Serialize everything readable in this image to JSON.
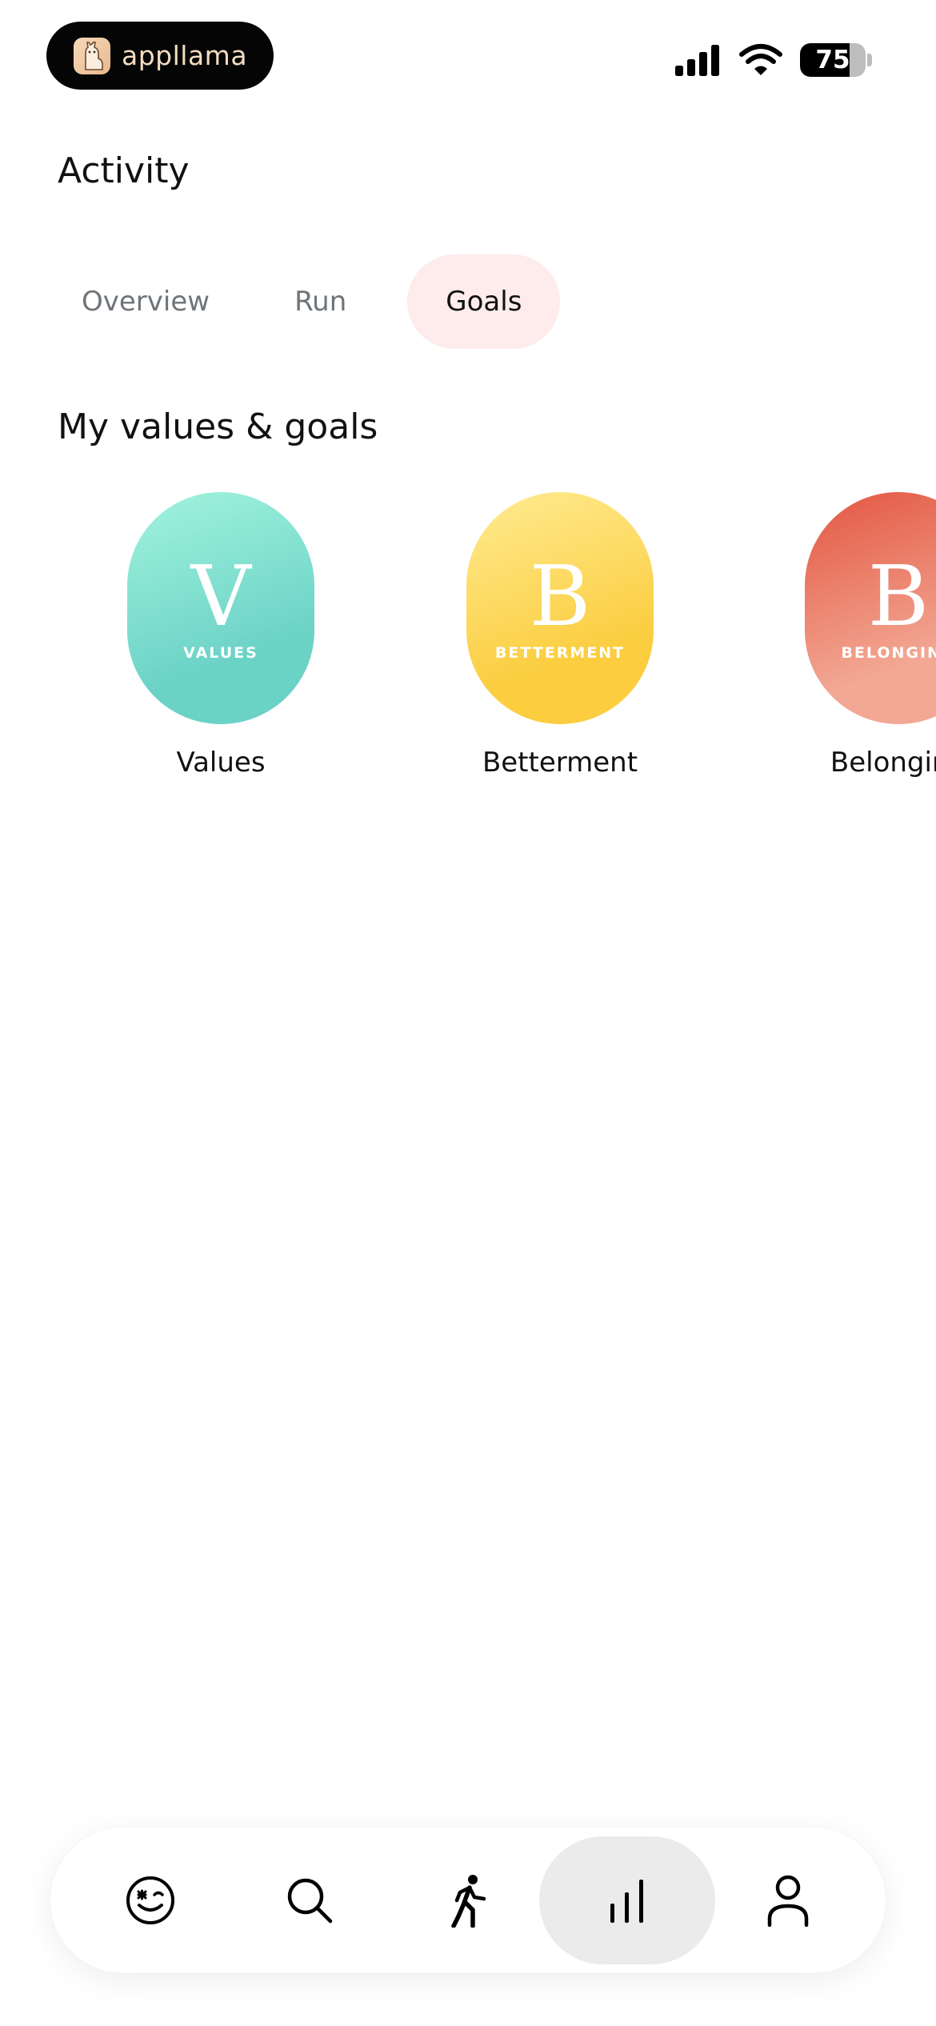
{
  "status_bar": {
    "brand": "appllama",
    "battery": "75",
    "battery_level": 0.75
  },
  "header": {
    "title": "Activity"
  },
  "tabs": [
    {
      "label": "Overview",
      "active": false
    },
    {
      "label": "Run",
      "active": false
    },
    {
      "label": "Goals",
      "active": true
    }
  ],
  "section": {
    "title": "My values & goals",
    "cards": [
      {
        "letter": "V",
        "caption": "VALUES",
        "label": "Values",
        "colors": [
          "#9ef1dc",
          "#6bd2c6"
        ]
      },
      {
        "letter": "B",
        "caption": "BETTERMENT",
        "label": "Betterment",
        "colors": [
          "#ffe98c",
          "#fbcd3f"
        ]
      },
      {
        "letter": "B",
        "caption": "BELONGING",
        "label": "Belonging",
        "colors": [
          "#e45c47",
          "#f2a894"
        ]
      }
    ]
  },
  "bottom_nav": {
    "items": [
      {
        "icon": "wink-face-icon",
        "active": false
      },
      {
        "icon": "search-icon",
        "active": false
      },
      {
        "icon": "running-person-icon",
        "active": false
      },
      {
        "icon": "bar-chart-icon",
        "active": true
      },
      {
        "icon": "person-icon",
        "active": false
      }
    ]
  }
}
